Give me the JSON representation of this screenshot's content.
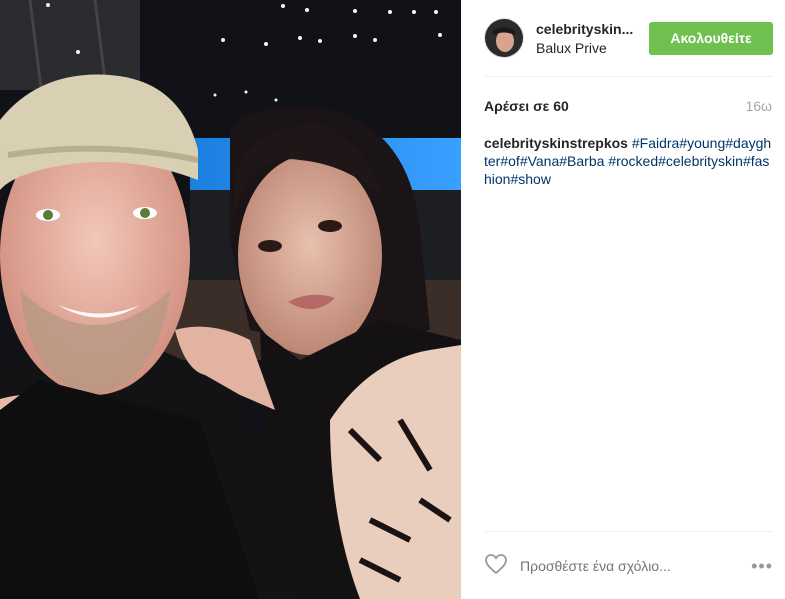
{
  "post": {
    "username": "celebrityskin...",
    "location": "Balux Prive",
    "follow_label": "Ακολουθείτε",
    "likes": "Αρέσει σε 60",
    "time": "16ω",
    "caption": {
      "author": "celebrityskinstrepkos",
      "tags": [
        "#Faidra",
        "#young",
        "#dayghter",
        "#of",
        "#Vana",
        "#Barba",
        "#rocked",
        "#celebrityskin",
        "#fashion",
        "#show"
      ]
    },
    "comment_placeholder": "Προσθέστε ένα σχόλιο...",
    "more_label": "•••"
  },
  "colors": {
    "follow": "#70c050",
    "hashtag": "#003569",
    "muted": "#a5a7aa"
  }
}
